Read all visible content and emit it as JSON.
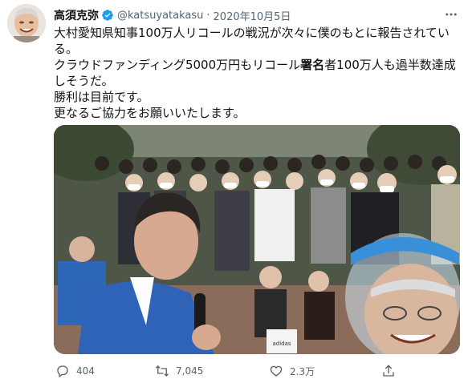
{
  "tweet": {
    "author": {
      "name": "高須克弥",
      "handle": "@katsuyatakasu",
      "date": "2020年10月5日",
      "verified_color": "#1d9bf0"
    },
    "more_icon": "more-horizontal-icon",
    "lines": [
      "大村愛知県知事100万人リコールの戦況が次々に僕のもとに報告されてい",
      "る。",
      "クラウドファンディング5000万円もリコール",
      "者100万人も過半数達成",
      "しそうだ。",
      "勝利は目前です。",
      "更なるご協力をお願いいたします。"
    ],
    "bold_word": "署名",
    "media": {
      "description_icon": "photo-image",
      "bag_text": "adidas"
    },
    "actions": {
      "reply": {
        "icon": "reply-icon",
        "count": "404"
      },
      "retweet": {
        "icon": "retweet-icon",
        "count": "7,045"
      },
      "like": {
        "icon": "heart-icon",
        "count": "2.3万"
      },
      "share": {
        "icon": "share-icon"
      }
    },
    "colors": {
      "text": "#0f1419",
      "secondary": "#536471",
      "accent": "#1d9bf0"
    }
  }
}
